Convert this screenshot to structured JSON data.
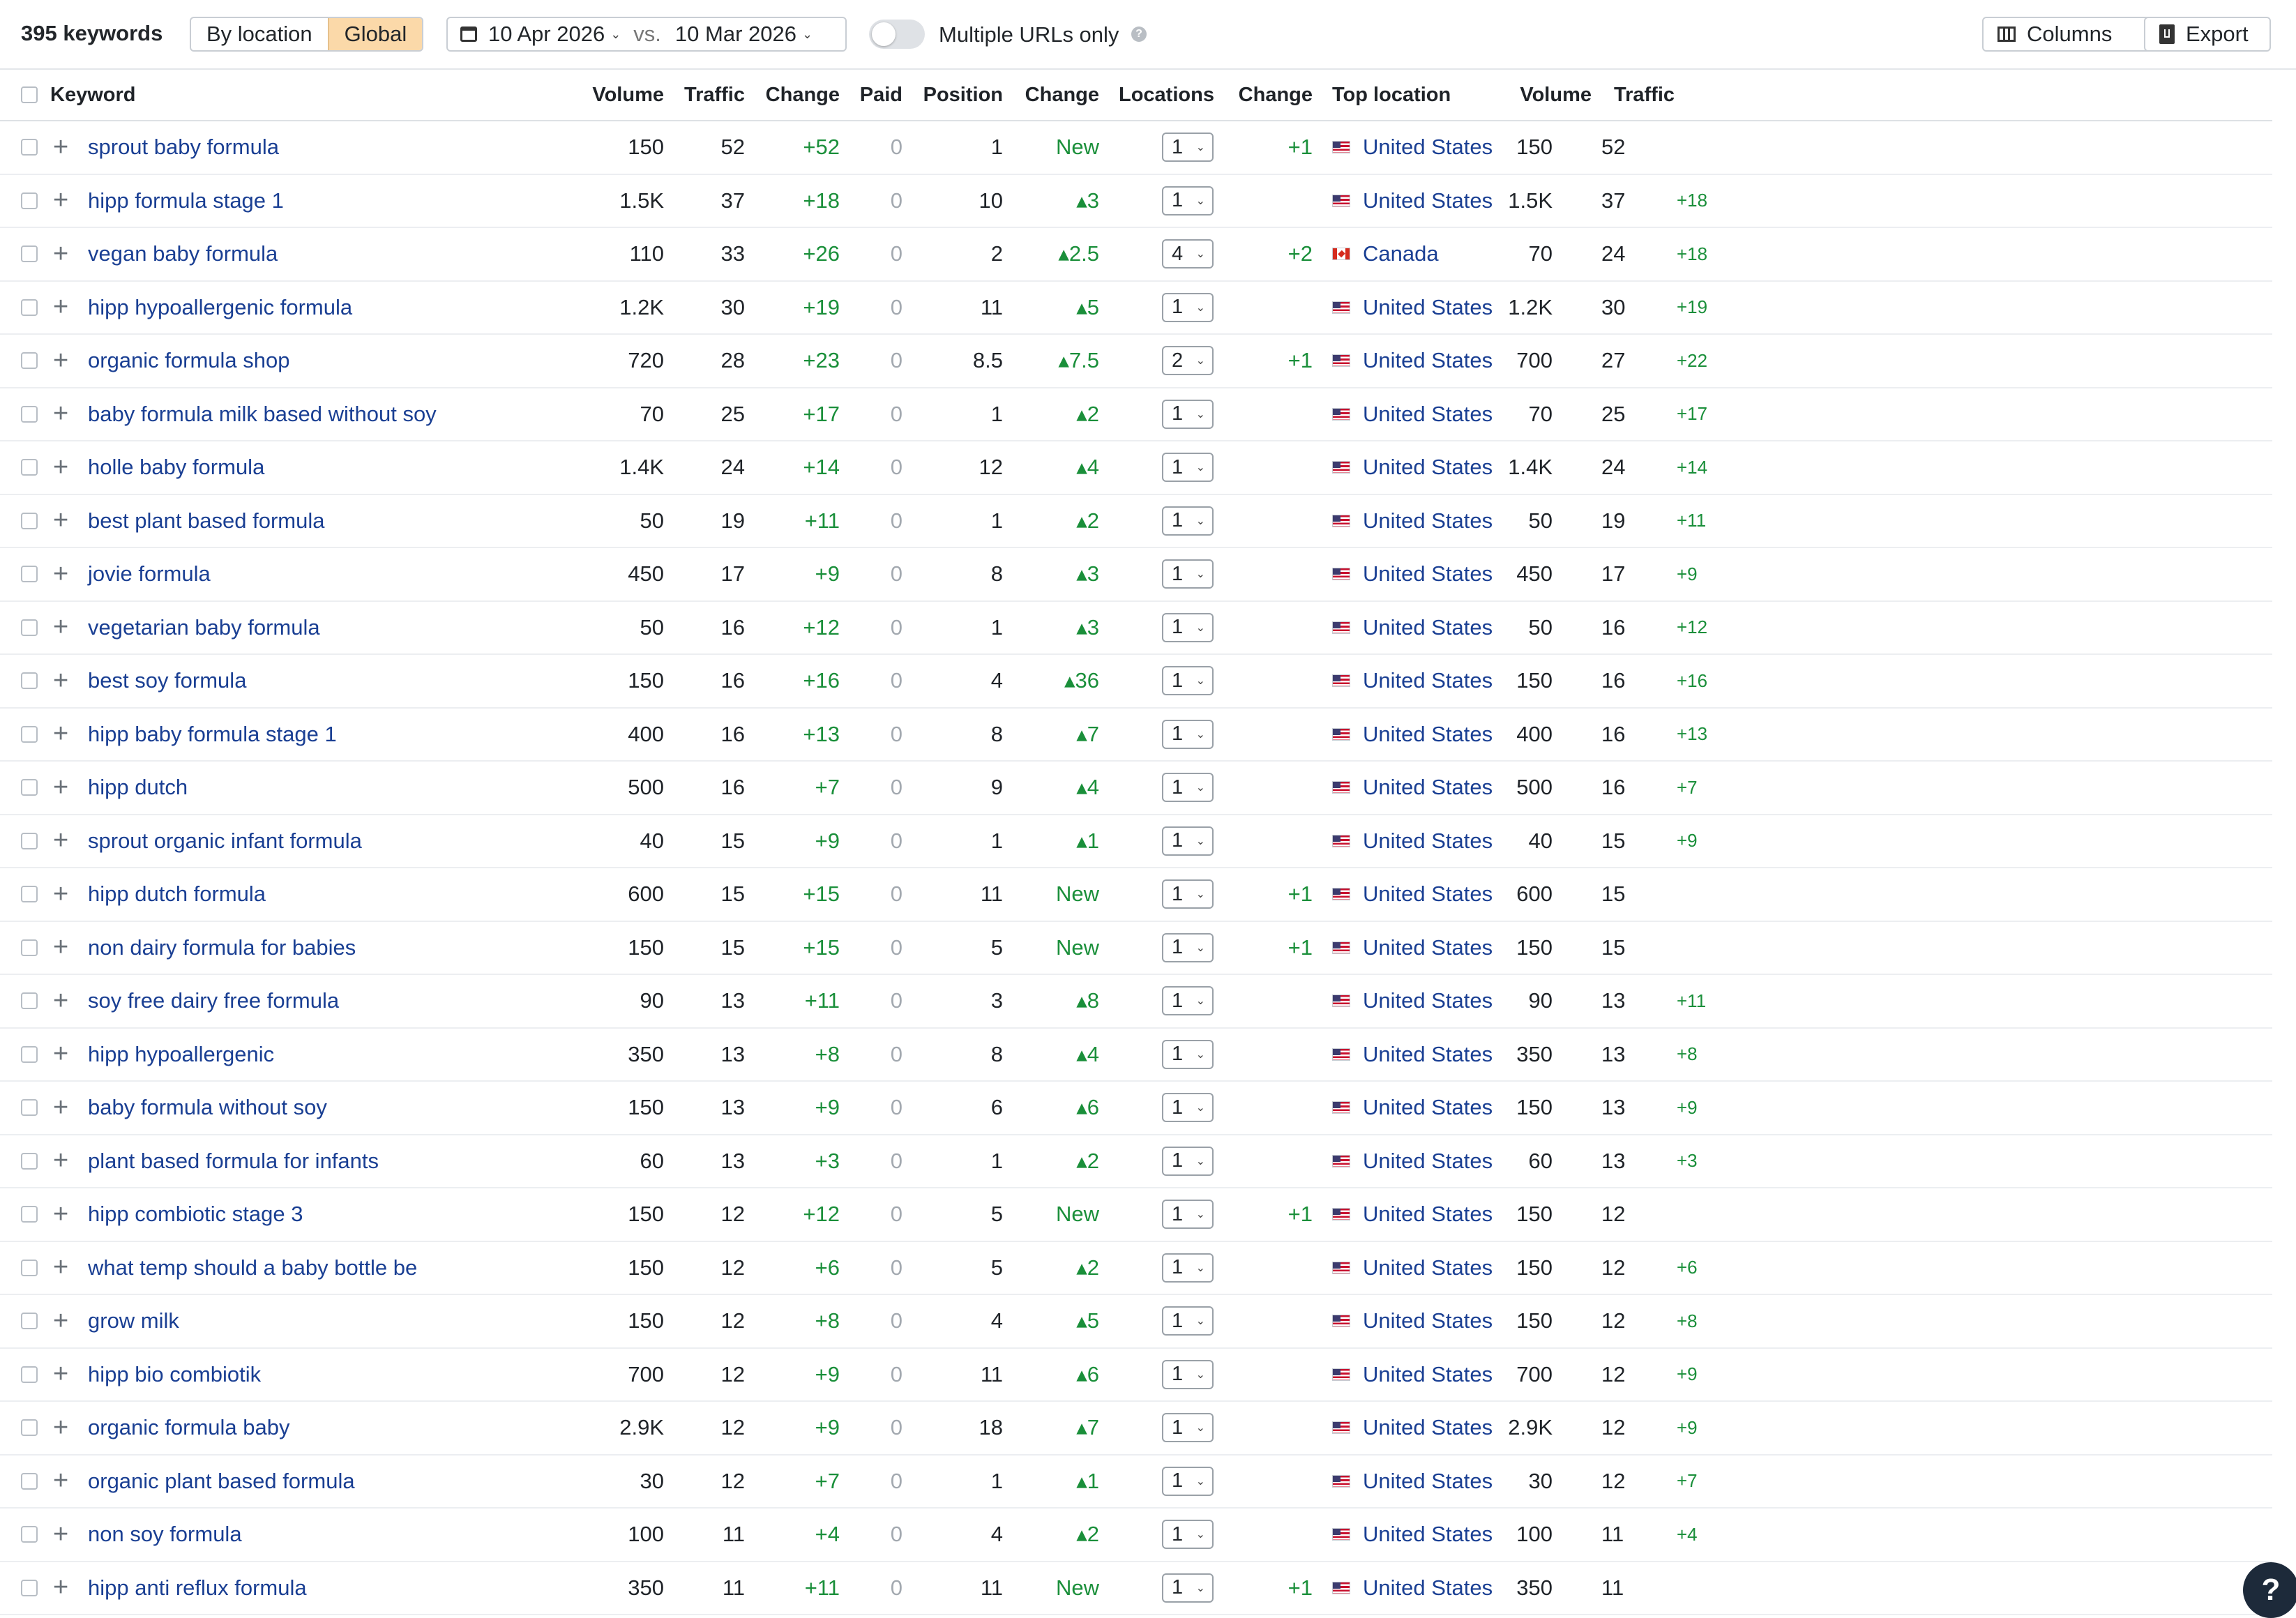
{
  "toolbar": {
    "keywords_count": "395 keywords",
    "segment": [
      "By location",
      "Global"
    ],
    "date_from": "10 Apr 2026",
    "vs": "vs.",
    "date_to": "10 Mar 2026",
    "multiple_urls": "Multiple URLs only",
    "help": "?",
    "columns": "Columns",
    "export": "Export"
  },
  "columns": {
    "keyword": "Keyword",
    "volume": "Volume",
    "traffic": "Traffic",
    "change": "Change",
    "paid": "Paid",
    "position": "Position",
    "position_change": "Change",
    "locations": "Locations",
    "locations_change": "Change",
    "top_location": "Top location",
    "top_volume": "Volume",
    "top_traffic": "Traffic"
  },
  "rows": [
    {
      "keyword": "sprout baby formula",
      "volume": "150",
      "traffic": "52",
      "change": "+52",
      "paid": "0",
      "position": "1",
      "pos_change": "New",
      "locations": "1",
      "loc_change": "+1",
      "country": "United States",
      "flag": "us",
      "t_volume": "150",
      "t_traffic": "52",
      "t_change": ""
    },
    {
      "keyword": "hipp formula stage 1",
      "volume": "1.5K",
      "traffic": "37",
      "change": "+18",
      "paid": "0",
      "position": "10",
      "pos_change": "▴3",
      "locations": "1",
      "loc_change": "",
      "country": "United States",
      "flag": "us",
      "t_volume": "1.5K",
      "t_traffic": "37",
      "t_change": "+18"
    },
    {
      "keyword": "vegan baby formula",
      "volume": "110",
      "traffic": "33",
      "change": "+26",
      "paid": "0",
      "position": "2",
      "pos_change": "▴2.5",
      "locations": "4",
      "loc_change": "+2",
      "country": "Canada",
      "flag": "ca",
      "t_volume": "70",
      "t_traffic": "24",
      "t_change": "+18"
    },
    {
      "keyword": "hipp hypoallergenic formula",
      "volume": "1.2K",
      "traffic": "30",
      "change": "+19",
      "paid": "0",
      "position": "11",
      "pos_change": "▴5",
      "locations": "1",
      "loc_change": "",
      "country": "United States",
      "flag": "us",
      "t_volume": "1.2K",
      "t_traffic": "30",
      "t_change": "+19"
    },
    {
      "keyword": "organic formula shop",
      "volume": "720",
      "traffic": "28",
      "change": "+23",
      "paid": "0",
      "position": "8.5",
      "pos_change": "▴7.5",
      "locations": "2",
      "loc_change": "+1",
      "country": "United States",
      "flag": "us",
      "t_volume": "700",
      "t_traffic": "27",
      "t_change": "+22"
    },
    {
      "keyword": "baby formula milk based without soy",
      "volume": "70",
      "traffic": "25",
      "change": "+17",
      "paid": "0",
      "position": "1",
      "pos_change": "▴2",
      "locations": "1",
      "loc_change": "",
      "country": "United States",
      "flag": "us",
      "t_volume": "70",
      "t_traffic": "25",
      "t_change": "+17"
    },
    {
      "keyword": "holle baby formula",
      "volume": "1.4K",
      "traffic": "24",
      "change": "+14",
      "paid": "0",
      "position": "12",
      "pos_change": "▴4",
      "locations": "1",
      "loc_change": "",
      "country": "United States",
      "flag": "us",
      "t_volume": "1.4K",
      "t_traffic": "24",
      "t_change": "+14"
    },
    {
      "keyword": "best plant based formula",
      "volume": "50",
      "traffic": "19",
      "change": "+11",
      "paid": "0",
      "position": "1",
      "pos_change": "▴2",
      "locations": "1",
      "loc_change": "",
      "country": "United States",
      "flag": "us",
      "t_volume": "50",
      "t_traffic": "19",
      "t_change": "+11"
    },
    {
      "keyword": "jovie formula",
      "volume": "450",
      "traffic": "17",
      "change": "+9",
      "paid": "0",
      "position": "8",
      "pos_change": "▴3",
      "locations": "1",
      "loc_change": "",
      "country": "United States",
      "flag": "us",
      "t_volume": "450",
      "t_traffic": "17",
      "t_change": "+9"
    },
    {
      "keyword": "vegetarian baby formula",
      "volume": "50",
      "traffic": "16",
      "change": "+12",
      "paid": "0",
      "position": "1",
      "pos_change": "▴3",
      "locations": "1",
      "loc_change": "",
      "country": "United States",
      "flag": "us",
      "t_volume": "50",
      "t_traffic": "16",
      "t_change": "+12"
    },
    {
      "keyword": "best soy formula",
      "volume": "150",
      "traffic": "16",
      "change": "+16",
      "paid": "0",
      "position": "4",
      "pos_change": "▴36",
      "locations": "1",
      "loc_change": "",
      "country": "United States",
      "flag": "us",
      "t_volume": "150",
      "t_traffic": "16",
      "t_change": "+16"
    },
    {
      "keyword": "hipp baby formula stage 1",
      "volume": "400",
      "traffic": "16",
      "change": "+13",
      "paid": "0",
      "position": "8",
      "pos_change": "▴7",
      "locations": "1",
      "loc_change": "",
      "country": "United States",
      "flag": "us",
      "t_volume": "400",
      "t_traffic": "16",
      "t_change": "+13"
    },
    {
      "keyword": "hipp dutch",
      "volume": "500",
      "traffic": "16",
      "change": "+7",
      "paid": "0",
      "position": "9",
      "pos_change": "▴4",
      "locations": "1",
      "loc_change": "",
      "country": "United States",
      "flag": "us",
      "t_volume": "500",
      "t_traffic": "16",
      "t_change": "+7"
    },
    {
      "keyword": "sprout organic infant formula",
      "volume": "40",
      "traffic": "15",
      "change": "+9",
      "paid": "0",
      "position": "1",
      "pos_change": "▴1",
      "locations": "1",
      "loc_change": "",
      "country": "United States",
      "flag": "us",
      "t_volume": "40",
      "t_traffic": "15",
      "t_change": "+9"
    },
    {
      "keyword": "hipp dutch formula",
      "volume": "600",
      "traffic": "15",
      "change": "+15",
      "paid": "0",
      "position": "11",
      "pos_change": "New",
      "locations": "1",
      "loc_change": "+1",
      "country": "United States",
      "flag": "us",
      "t_volume": "600",
      "t_traffic": "15",
      "t_change": ""
    },
    {
      "keyword": "non dairy formula for babies",
      "volume": "150",
      "traffic": "15",
      "change": "+15",
      "paid": "0",
      "position": "5",
      "pos_change": "New",
      "locations": "1",
      "loc_change": "+1",
      "country": "United States",
      "flag": "us",
      "t_volume": "150",
      "t_traffic": "15",
      "t_change": ""
    },
    {
      "keyword": "soy free dairy free formula",
      "volume": "90",
      "traffic": "13",
      "change": "+11",
      "paid": "0",
      "position": "3",
      "pos_change": "▴8",
      "locations": "1",
      "loc_change": "",
      "country": "United States",
      "flag": "us",
      "t_volume": "90",
      "t_traffic": "13",
      "t_change": "+11"
    },
    {
      "keyword": "hipp hypoallergenic",
      "volume": "350",
      "traffic": "13",
      "change": "+8",
      "paid": "0",
      "position": "8",
      "pos_change": "▴4",
      "locations": "1",
      "loc_change": "",
      "country": "United States",
      "flag": "us",
      "t_volume": "350",
      "t_traffic": "13",
      "t_change": "+8"
    },
    {
      "keyword": "baby formula without soy",
      "volume": "150",
      "traffic": "13",
      "change": "+9",
      "paid": "0",
      "position": "6",
      "pos_change": "▴6",
      "locations": "1",
      "loc_change": "",
      "country": "United States",
      "flag": "us",
      "t_volume": "150",
      "t_traffic": "13",
      "t_change": "+9"
    },
    {
      "keyword": "plant based formula for infants",
      "volume": "60",
      "traffic": "13",
      "change": "+3",
      "paid": "0",
      "position": "1",
      "pos_change": "▴2",
      "locations": "1",
      "loc_change": "",
      "country": "United States",
      "flag": "us",
      "t_volume": "60",
      "t_traffic": "13",
      "t_change": "+3"
    },
    {
      "keyword": "hipp combiotic stage 3",
      "volume": "150",
      "traffic": "12",
      "change": "+12",
      "paid": "0",
      "position": "5",
      "pos_change": "New",
      "locations": "1",
      "loc_change": "+1",
      "country": "United States",
      "flag": "us",
      "t_volume": "150",
      "t_traffic": "12",
      "t_change": ""
    },
    {
      "keyword": "what temp should a baby bottle be",
      "volume": "150",
      "traffic": "12",
      "change": "+6",
      "paid": "0",
      "position": "5",
      "pos_change": "▴2",
      "locations": "1",
      "loc_change": "",
      "country": "United States",
      "flag": "us",
      "t_volume": "150",
      "t_traffic": "12",
      "t_change": "+6"
    },
    {
      "keyword": "grow milk",
      "volume": "150",
      "traffic": "12",
      "change": "+8",
      "paid": "0",
      "position": "4",
      "pos_change": "▴5",
      "locations": "1",
      "loc_change": "",
      "country": "United States",
      "flag": "us",
      "t_volume": "150",
      "t_traffic": "12",
      "t_change": "+8"
    },
    {
      "keyword": "hipp bio combiotik",
      "volume": "700",
      "traffic": "12",
      "change": "+9",
      "paid": "0",
      "position": "11",
      "pos_change": "▴6",
      "locations": "1",
      "loc_change": "",
      "country": "United States",
      "flag": "us",
      "t_volume": "700",
      "t_traffic": "12",
      "t_change": "+9"
    },
    {
      "keyword": "organic formula baby",
      "volume": "2.9K",
      "traffic": "12",
      "change": "+9",
      "paid": "0",
      "position": "18",
      "pos_change": "▴7",
      "locations": "1",
      "loc_change": "",
      "country": "United States",
      "flag": "us",
      "t_volume": "2.9K",
      "t_traffic": "12",
      "t_change": "+9"
    },
    {
      "keyword": "organic plant based formula",
      "volume": "30",
      "traffic": "12",
      "change": "+7",
      "paid": "0",
      "position": "1",
      "pos_change": "▴1",
      "locations": "1",
      "loc_change": "",
      "country": "United States",
      "flag": "us",
      "t_volume": "30",
      "t_traffic": "12",
      "t_change": "+7"
    },
    {
      "keyword": "non soy formula",
      "volume": "100",
      "traffic": "11",
      "change": "+4",
      "paid": "0",
      "position": "4",
      "pos_change": "▴2",
      "locations": "1",
      "loc_change": "",
      "country": "United States",
      "flag": "us",
      "t_volume": "100",
      "t_traffic": "11",
      "t_change": "+4"
    },
    {
      "keyword": "hipp anti reflux formula",
      "volume": "350",
      "traffic": "11",
      "change": "+11",
      "paid": "0",
      "position": "11",
      "pos_change": "New",
      "locations": "1",
      "loc_change": "+1",
      "country": "United States",
      "flag": "us",
      "t_volume": "350",
      "t_traffic": "11",
      "t_change": ""
    }
  ]
}
